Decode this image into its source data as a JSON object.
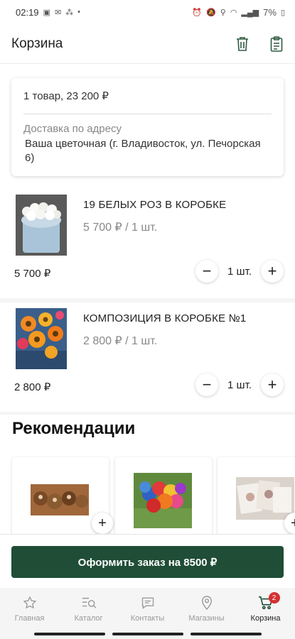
{
  "status_bar": {
    "time": "02:19",
    "battery": "7%"
  },
  "header": {
    "title": "Корзина"
  },
  "summary": {
    "count_total": "1 товар, 23 200 ₽",
    "delivery_label": "Доставка по адресу",
    "address": "Ваша цветочная (г. Владивосток, ул. Печорская 6)"
  },
  "items": [
    {
      "name": "19 БЕЛЫХ  РОЗ В КОРОБКЕ",
      "unit_price": "5 700 ₽ / 1 шт.",
      "total": "5 700 ₽",
      "qty": "1 шт."
    },
    {
      "name": "КОМПОЗИЦИЯ В КОРОБКЕ №1",
      "unit_price": "2 800 ₽ / 1 шт.",
      "total": "2 800 ₽",
      "qty": "1 шт."
    }
  ],
  "recommendations": {
    "title": "Рекомендации"
  },
  "checkout": {
    "label": "Оформить заказ на 8500 ₽"
  },
  "nav": {
    "home": "Главная",
    "catalog": "Каталог",
    "contacts": "Контакты",
    "stores": "Магазины",
    "cart": "Корзина",
    "cart_badge": "2"
  },
  "colors": {
    "primary": "#1f4d36",
    "badge": "#d63030"
  }
}
